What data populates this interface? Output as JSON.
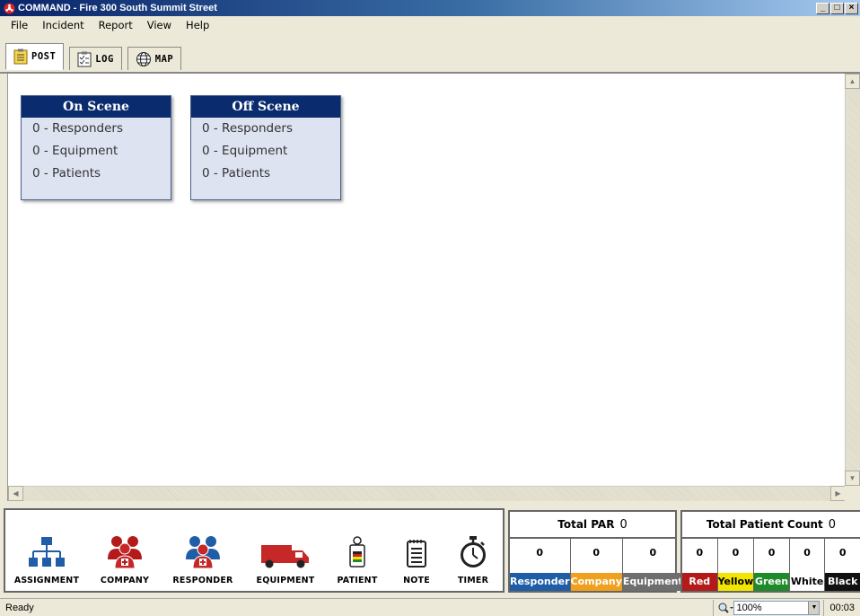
{
  "window": {
    "title": "COMMAND - Fire 300 South Summit Street"
  },
  "menu": [
    "File",
    "Incident",
    "Report",
    "View",
    "Help"
  ],
  "tabs": [
    {
      "label": "POST",
      "icon": "clipboard-icon"
    },
    {
      "label": "LOG",
      "icon": "checklist-icon"
    },
    {
      "label": "MAP",
      "icon": "globe-icon"
    }
  ],
  "on_scene": {
    "title": "On Scene",
    "lines": [
      "0 - Responders",
      "0 - Equipment",
      "0 - Patients"
    ]
  },
  "off_scene": {
    "title": "Off Scene",
    "lines": [
      "0 - Responders",
      "0 - Equipment",
      "0 - Patients"
    ]
  },
  "tools": [
    {
      "label": "ASSIGNMENT",
      "icon": "org-chart-icon"
    },
    {
      "label": "COMPANY",
      "icon": "company-icon"
    },
    {
      "label": "RESPONDER",
      "icon": "responder-icon"
    },
    {
      "label": "EQUIPMENT",
      "icon": "fire-truck-icon"
    },
    {
      "label": "PATIENT",
      "icon": "triage-tag-icon"
    },
    {
      "label": "NOTE",
      "icon": "notepad-icon"
    },
    {
      "label": "TIMER",
      "icon": "stopwatch-icon"
    }
  ],
  "par": {
    "title": "Total PAR",
    "count": "0",
    "cells": [
      {
        "value": "0",
        "label": "Responder",
        "color": "#1f5da6"
      },
      {
        "value": "0",
        "label": "Company",
        "color": "#f0a01e"
      },
      {
        "value": "0",
        "label": "Equipment",
        "color": "#6e6e6e"
      }
    ]
  },
  "patients": {
    "title": "Total Patient Count",
    "count": "0",
    "cells": [
      {
        "value": "0",
        "label": "Red",
        "color": "#b31b1b",
        "text": "#ffffff"
      },
      {
        "value": "0",
        "label": "Yellow",
        "color": "#f2e600",
        "text": "#000000"
      },
      {
        "value": "0",
        "label": "Green",
        "color": "#1f8a2a",
        "text": "#ffffff"
      },
      {
        "value": "0",
        "label": "White",
        "color": "#ffffff",
        "text": "#000000"
      },
      {
        "value": "0",
        "label": "Black",
        "color": "#111111",
        "text": "#ffffff"
      }
    ]
  },
  "status": {
    "text": "Ready",
    "zoom": "100%",
    "timer": "00:03"
  }
}
